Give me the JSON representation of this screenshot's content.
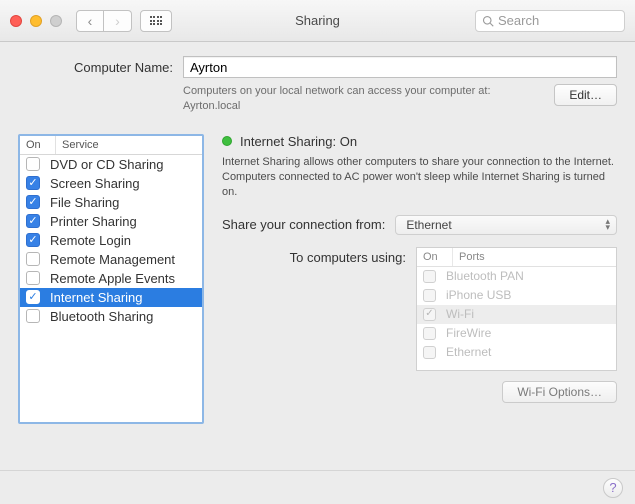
{
  "window": {
    "title": "Sharing"
  },
  "search": {
    "placeholder": "Search"
  },
  "computer_name": {
    "label": "Computer Name:",
    "value": "Ayrton",
    "sub1": "Computers on your local network can access your computer at:",
    "sub2": "Ayrton.local",
    "edit": "Edit…"
  },
  "services": {
    "head_on": "On",
    "head_service": "Service",
    "items": [
      {
        "label": "DVD or CD Sharing",
        "on": false
      },
      {
        "label": "Screen Sharing",
        "on": true
      },
      {
        "label": "File Sharing",
        "on": true
      },
      {
        "label": "Printer Sharing",
        "on": true
      },
      {
        "label": "Remote Login",
        "on": true
      },
      {
        "label": "Remote Management",
        "on": false
      },
      {
        "label": "Remote Apple Events",
        "on": false
      },
      {
        "label": "Internet Sharing",
        "on": true,
        "selected": true
      },
      {
        "label": "Bluetooth Sharing",
        "on": false
      }
    ]
  },
  "detail": {
    "status_label": "Internet Sharing:",
    "status_value": "On",
    "description": "Internet Sharing allows other computers to share your connection to the Internet. Computers connected to AC power won't sleep while Internet Sharing is turned on.",
    "share_from_label": "Share your connection from:",
    "share_from_value": "Ethernet",
    "to_label": "To computers using:",
    "ports_head_on": "On",
    "ports_head_ports": "Ports",
    "ports": [
      {
        "label": "Bluetooth PAN",
        "on": false
      },
      {
        "label": "iPhone USB",
        "on": false
      },
      {
        "label": "Wi-Fi",
        "on": true,
        "selected": true
      },
      {
        "label": "FireWire",
        "on": false
      },
      {
        "label": "Ethernet",
        "on": false
      }
    ],
    "wifi_options": "Wi-Fi Options…"
  },
  "help_glyph": "?"
}
